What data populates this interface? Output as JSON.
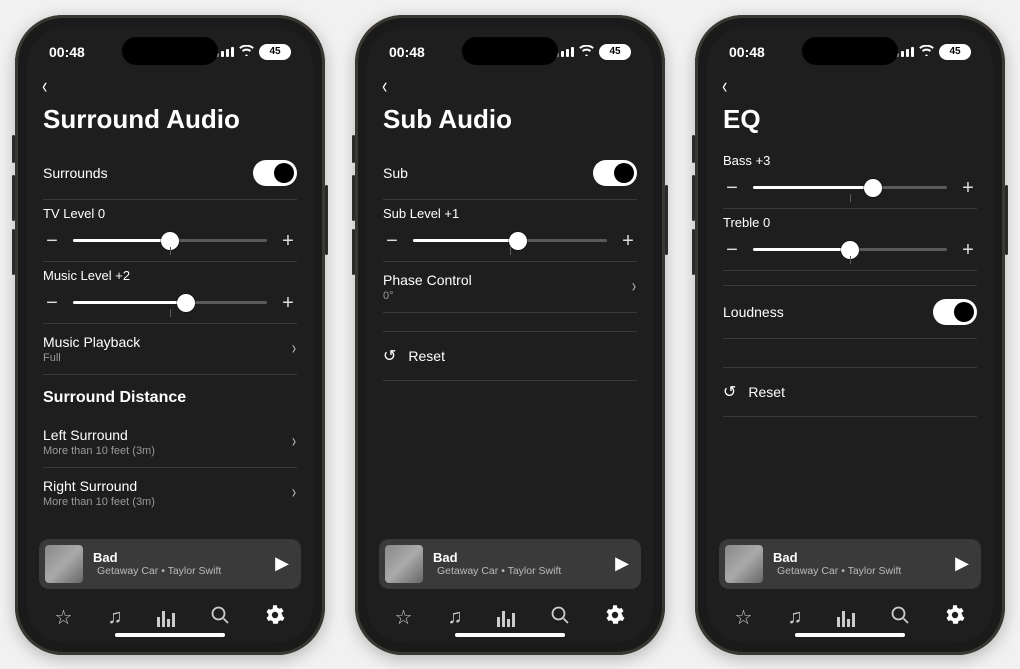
{
  "status": {
    "time": "00:48",
    "battery": "45"
  },
  "miniplayer": {
    "title": "Bad",
    "subtitle": "Getaway Car • Taylor Swift"
  },
  "screens": [
    {
      "title": "Surround Audio",
      "toggle": {
        "label": "Surrounds",
        "on": true
      },
      "sliders": [
        {
          "label": "TV Level 0",
          "percent": 50
        },
        {
          "label": "Music Level +2",
          "percent": 58
        }
      ],
      "nav1": {
        "title": "Music Playback",
        "sub": "Full"
      },
      "section": "Surround Distance",
      "distRows": [
        {
          "title": "Left Surround",
          "sub": "More than 10 feet (3m)"
        },
        {
          "title": "Right Surround",
          "sub": "More than 10 feet (3m)"
        }
      ]
    },
    {
      "title": "Sub Audio",
      "toggle": {
        "label": "Sub",
        "on": true
      },
      "sliders": [
        {
          "label": "Sub Level +1",
          "percent": 54
        }
      ],
      "nav1": {
        "title": "Phase Control",
        "sub": "0°"
      },
      "reset": "Reset"
    },
    {
      "title": "EQ",
      "sliders": [
        {
          "label": "Bass +3",
          "percent": 62
        },
        {
          "label": "Treble 0",
          "percent": 50
        }
      ],
      "toggle": {
        "label": "Loudness",
        "on": true
      },
      "reset": "Reset"
    }
  ]
}
